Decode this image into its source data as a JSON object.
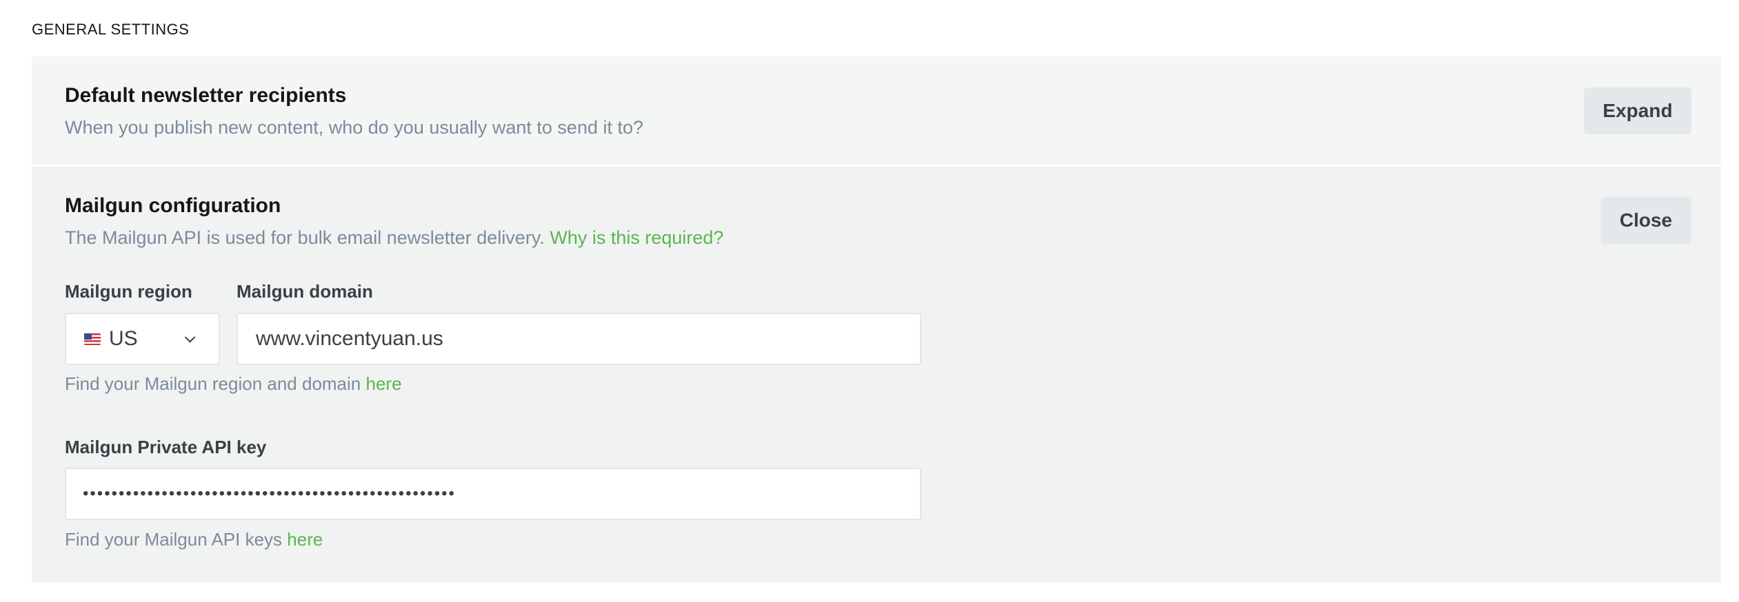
{
  "section": {
    "heading": "GENERAL SETTINGS"
  },
  "recipients": {
    "title": "Default newsletter recipients",
    "description": "When you publish new content, who do you usually want to send it to?",
    "expand_label": "Expand"
  },
  "mailgun": {
    "title": "Mailgun configuration",
    "description": "The Mailgun API is used for bulk email newsletter delivery.",
    "why_link": "Why is this required?",
    "close_label": "Close",
    "region": {
      "label": "Mailgun region",
      "value": "US",
      "flag_icon": "us-flag-icon"
    },
    "domain": {
      "label": "Mailgun domain",
      "value": "www.vincentyuan.us"
    },
    "region_hint": {
      "text": "Find your Mailgun region and domain",
      "link": "here"
    },
    "api_key": {
      "label": "Mailgun Private API key",
      "value": "••••••••••••••••••••••••••••••••••••••••••••••••••••"
    },
    "api_hint": {
      "text": "Find your Mailgun API keys",
      "link": "here"
    }
  },
  "colors": {
    "accent_green": "#5ab64f",
    "muted_text": "#7c8b9a",
    "panel_bg": "#f4f5f5",
    "button_bg": "#e5e8ea"
  }
}
